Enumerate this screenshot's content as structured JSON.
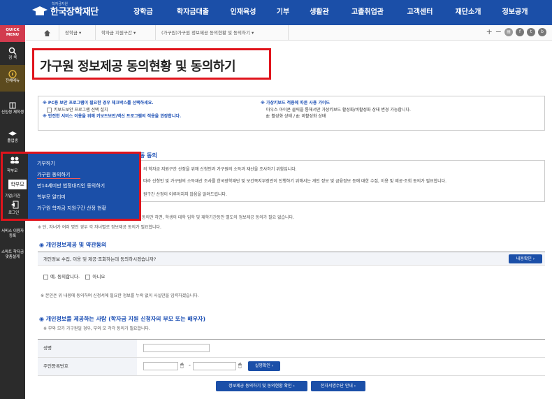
{
  "header": {
    "logo_small": "학자금지원",
    "logo_name": "한국장학재단",
    "nav": [
      "장학금",
      "학자금대출",
      "인재육성",
      "기부",
      "생활관",
      "고졸취업관",
      "고객센터",
      "재단소개",
      "정보공개"
    ]
  },
  "sidebar": {
    "quick": "QUICK MENU",
    "items": [
      "검 색",
      "전체메뉴",
      "신입생 재학생",
      "졸업생",
      "학부모",
      "기업/기관",
      "로그인",
      "서비스 이용자 등록",
      "스마트 학자금 맞춤설계"
    ]
  },
  "breadcrumb": {
    "items": [
      "장학금",
      "학자금 지원구간",
      "(가구원)가구원 정보제공 동의현황 및 동의하기"
    ]
  },
  "page": {
    "title": "가구원 정보제공 동의현황 및 동의하기"
  },
  "guide": {
    "pc_title": "※ PC용 보안 프로그램이 필요한 경우 체크박스를 선택하세요.",
    "pc_option": "키보드보안 프로그램 선택 설치",
    "pc_note": "※ 안전한 서비스 이용을 위해 키보드보안/백신 프로그램의 적용을 권장합니다.",
    "vk_title": "※ 가상키보드 적용에 따른 사용 가이드",
    "vk_desc": "마우스 아이콘 클릭을 통해서만 가상키보드 활성화/비활성화 상태 변경 가능합니다.",
    "vk_state": ": 활성화 상태 / ",
    "vk_state2": ": 비활성화 상태"
  },
  "dropdown": {
    "current": "학부모",
    "items": [
      "기부하기",
      "가구원 동의하기",
      "만14세미만 법정대리인 동의하기",
      "학부모 알리미",
      "가구원 학자금 지원구간 산정 현황"
    ]
  },
  "consent_section": {
    "title_suffix": "동 동의",
    "lines": [
      "의 학자금 지원구간 산정을 위해 신청인과 가구원의 소득과 재산을 조사하기 위함입니다.",
      "따라 신청인 및 가구원의 소득재산 조사를 한국장학재단 및 보건복지부장관이 진행하기 위해서는 개인 정보 및 금융정보 등에 대한 수집, 이용 및 제공·조회 동의가 필요합니다.",
      "원구간 산정이 이루어지지 않음을 알려드립니다."
    ],
    "note1": "동의만 하면, 학생의 대학 입학 및 재학기간동안 별도의 정보제공 동의가 필요 없습니다.",
    "note2": "※ 단, 자녀가 여러 명인 경우 각 자녀별로 정보제공 동의가 필요합니다."
  },
  "privacy": {
    "title": "개인정보제공 및 약관동의",
    "question": "개인정보 수집, 이용 및 제공·조회하는데 동의하시겠습니까?",
    "detail_btn": "내용확인",
    "yes": "예, 동의합니다.",
    "no": "아니오",
    "note": "※ 본인은 위 내용에 동의하며 신청서에 필요한 정보를 누락 없이 사실만을 입력하겠습니다."
  },
  "provider": {
    "title": "개인정보를 제공하는 사람 (학자금 지원 신청자의 부모 또는 배우자)",
    "note": "※ 부와 모가 가구원일 경우, 부와 모 각각 동의가 필요합니다.",
    "name_label": "성명",
    "rrn_label": "주민등록번호",
    "rrn_dash": "-",
    "verify_btn": "실명확인"
  },
  "buttons": {
    "status": "정보제공 동의하기 및 동의현황 확인",
    "cert": "전자서명수단 안내"
  },
  "colors": {
    "brand_blue": "#1b4fa8",
    "highlight_red": "#e0141c",
    "sidebar_dark": "#2b2b2b",
    "quick_red": "#d23b4e"
  }
}
